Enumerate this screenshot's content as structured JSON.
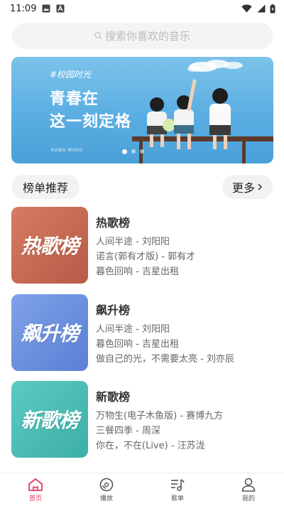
{
  "status_bar": {
    "time": "11:09"
  },
  "search": {
    "placeholder": "搜索你喜欢的音乐"
  },
  "banner": {
    "tag": "#校园时光",
    "title_line1": "青春在",
    "title_line2": "这一刻定格",
    "brand": "KUWO MUSIC"
  },
  "section": {
    "title": "榜单推荐",
    "more_label": "更多"
  },
  "charts": [
    {
      "cover_text": "热歌榜",
      "name": "热歌榜",
      "cover_color": "#c46a55",
      "tracks": [
        "人间半途 - 刘阳阳",
        "诺言(郭有才版) - 郭有才",
        "暮色回响 - 吉星出租"
      ]
    },
    {
      "cover_text": "飙升榜",
      "name": "飙升榜",
      "cover_color": "#6b8fdc",
      "tracks": [
        "人间半途 - 刘阳阳",
        "暮色回响 - 吉星出租",
        "做自己的光，不需要太亮 - 刘亦辰"
      ]
    },
    {
      "cover_text": "新歌榜",
      "name": "新歌榜",
      "cover_color": "#4dbdb6",
      "tracks": [
        "万物生(电子木鱼版) - 赛博九方",
        "三餐四季 - 周深",
        "你在，不在(Live) - 汪苏泷"
      ]
    }
  ],
  "bottom_nav": [
    {
      "label": "首页",
      "icon": "home-icon",
      "active": true
    },
    {
      "label": "播放",
      "icon": "disc-icon",
      "active": false
    },
    {
      "label": "歌单",
      "icon": "playlist-icon",
      "active": false
    },
    {
      "label": "我的",
      "icon": "user-icon",
      "active": false
    }
  ],
  "colors": {
    "accent": "#e8365f"
  }
}
